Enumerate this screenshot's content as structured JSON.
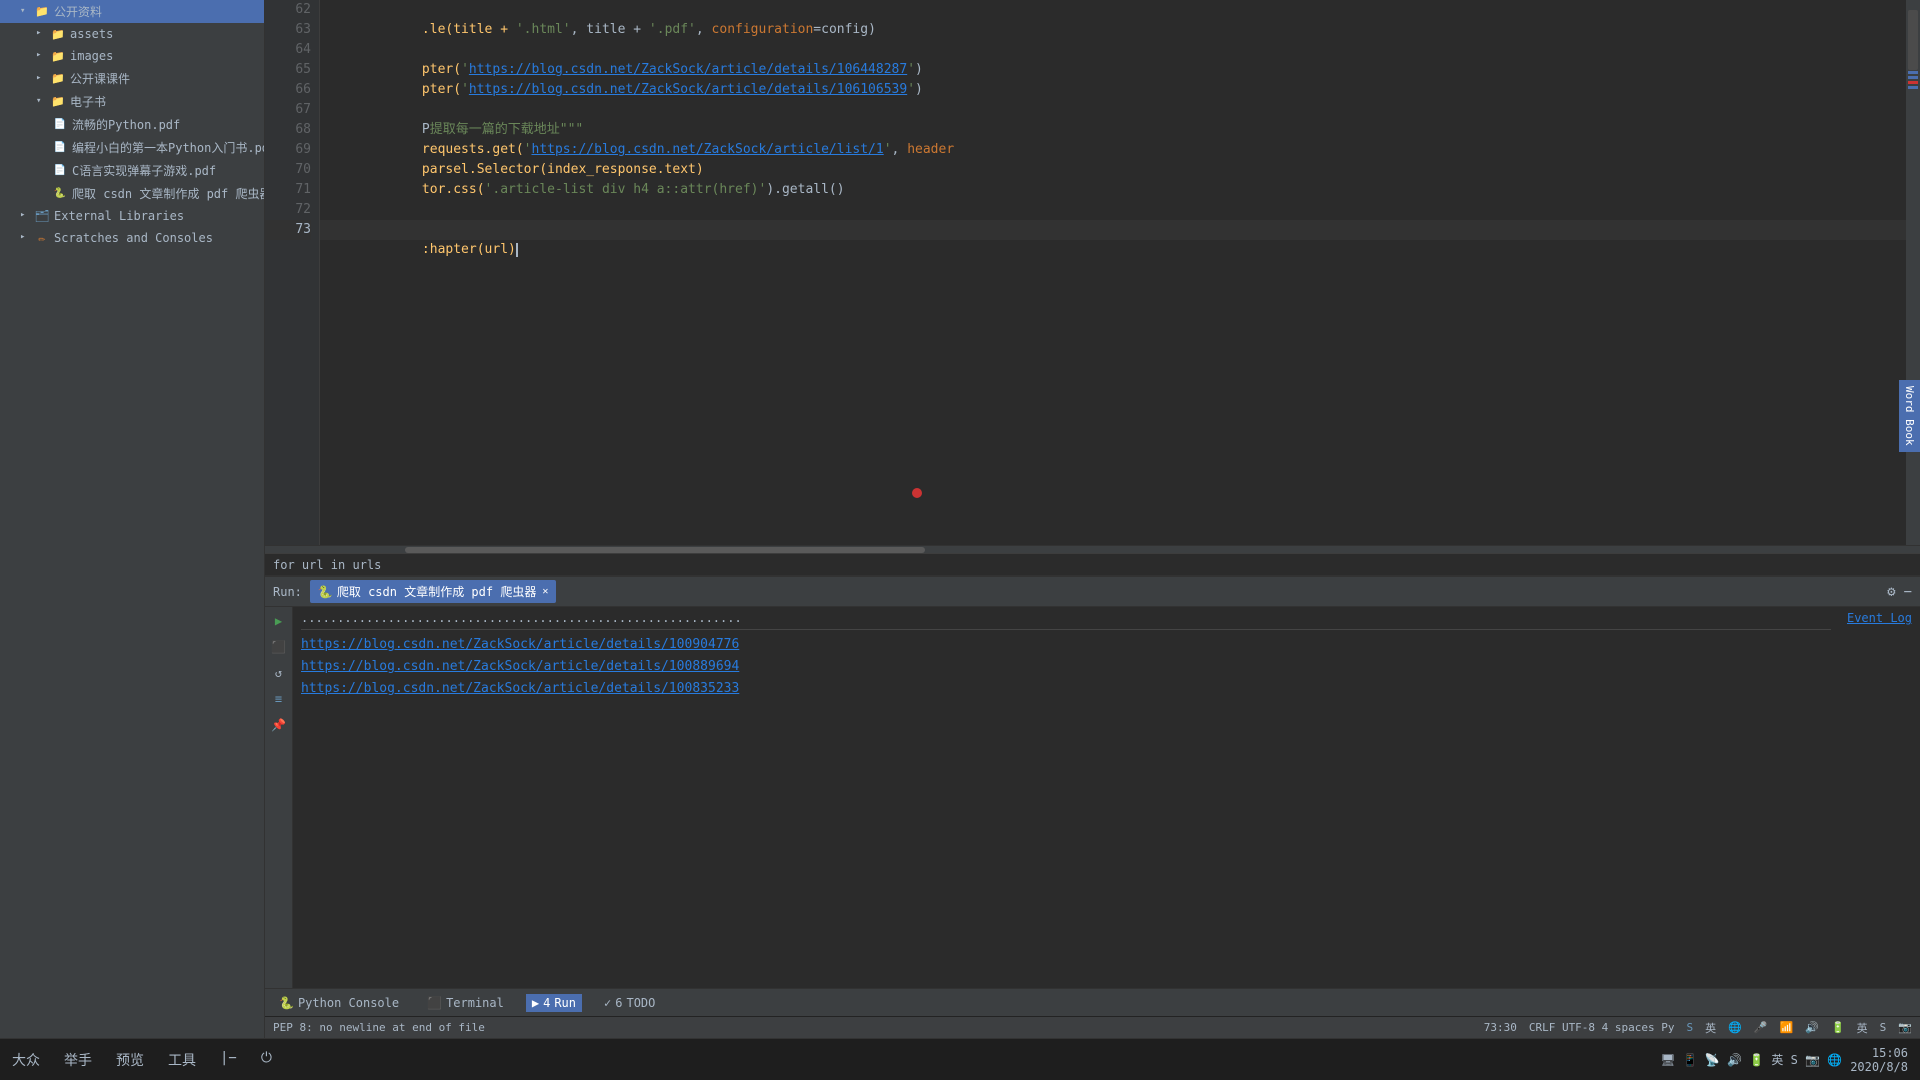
{
  "sidebar": {
    "items": [
      {
        "label": "公开资料",
        "type": "folder",
        "indent": 0,
        "expanded": true
      },
      {
        "label": "assets",
        "type": "folder",
        "indent": 1,
        "expanded": false
      },
      {
        "label": "images",
        "type": "folder",
        "indent": 1,
        "expanded": false
      },
      {
        "label": "公开课课件",
        "type": "folder",
        "indent": 1,
        "expanded": false
      },
      {
        "label": "电子书",
        "type": "folder",
        "indent": 1,
        "expanded": true
      },
      {
        "label": "流畅的Python.pdf",
        "type": "pdf",
        "indent": 2
      },
      {
        "label": "编程小白的第一本Python入门书.pdf",
        "type": "pdf",
        "indent": 2
      },
      {
        "label": "C语言实现弹幕子游戏.pdf",
        "type": "pdf",
        "indent": 2
      },
      {
        "label": "爬取 csdn 文章制作成 pdf 爬虫器.py",
        "type": "py",
        "indent": 2
      },
      {
        "label": "External Libraries",
        "type": "folder-ext",
        "indent": 0,
        "expanded": false
      },
      {
        "label": "Scratches and Consoles",
        "type": "scratches",
        "indent": 0,
        "expanded": false
      }
    ]
  },
  "editor": {
    "lines": [
      {
        "num": 62,
        "content_raw": ".le(title + '.html', title + '.pdf', configuration=config)",
        "active": false
      },
      {
        "num": 63,
        "content_raw": "",
        "active": false
      },
      {
        "num": 64,
        "content_raw": "pter('https://blog.csdn.net/ZackSock/article/details/106448287')",
        "active": false
      },
      {
        "num": 65,
        "content_raw": "pter('https://blog.csdn.net/ZackSock/article/details/106106539')",
        "active": false
      },
      {
        "num": 66,
        "content_raw": "",
        "active": false
      },
      {
        "num": 67,
        "content_raw": "P提取每一篇的下载地址\"\"\"",
        "active": false
      },
      {
        "num": 68,
        "content_raw": "requests.get('https://blog.csdn.net/ZackSock/article/list/1', header",
        "active": false
      },
      {
        "num": 69,
        "content_raw": "parsel.Selector(index_response.text)",
        "active": false
      },
      {
        "num": 70,
        "content_raw": "tor.css('.article-list div h4 a::attr(href)').getall()",
        "active": false
      },
      {
        "num": 71,
        "content_raw": "",
        "active": false
      },
      {
        "num": 72,
        "content_raw": "",
        "active": false
      },
      {
        "num": 73,
        "content_raw": ":hapter(url)",
        "active": true
      }
    ]
  },
  "tooltip": {
    "text": "for url in urls"
  },
  "run_panel": {
    "label": "Run:",
    "tab_name": "爬取 csdn 文章制作成 pdf 爬虫器",
    "ellipsis": "...........",
    "links": [
      "https://blog.csdn.net/ZackSock/article/details/100904776",
      "https://blog.csdn.net/ZackSock/article/details/100889694",
      "https://blog.csdn.net/ZackSock/article/details/100835233"
    ],
    "event_log": "Event Log"
  },
  "bottom_tabs": [
    {
      "label": "Python Console",
      "icon": "🐍",
      "active": false
    },
    {
      "label": "Terminal",
      "icon": "⬛",
      "active": false
    },
    {
      "label": "Run",
      "icon": "▶",
      "active": true,
      "num": "4"
    },
    {
      "label": "TODO",
      "icon": "✓",
      "num": "6",
      "active": false
    }
  ],
  "status_bar": {
    "position": "73:30",
    "encoding": "CRLF  UTF-8  4 spaces  Py",
    "warning": "PEP 8: no newline at end of file"
  },
  "taskbar": {
    "left_items": [
      "大众",
      "举手",
      "预览",
      "工具"
    ],
    "time": "15:06",
    "date": "2020/8/8"
  },
  "word_book": "Word Book"
}
